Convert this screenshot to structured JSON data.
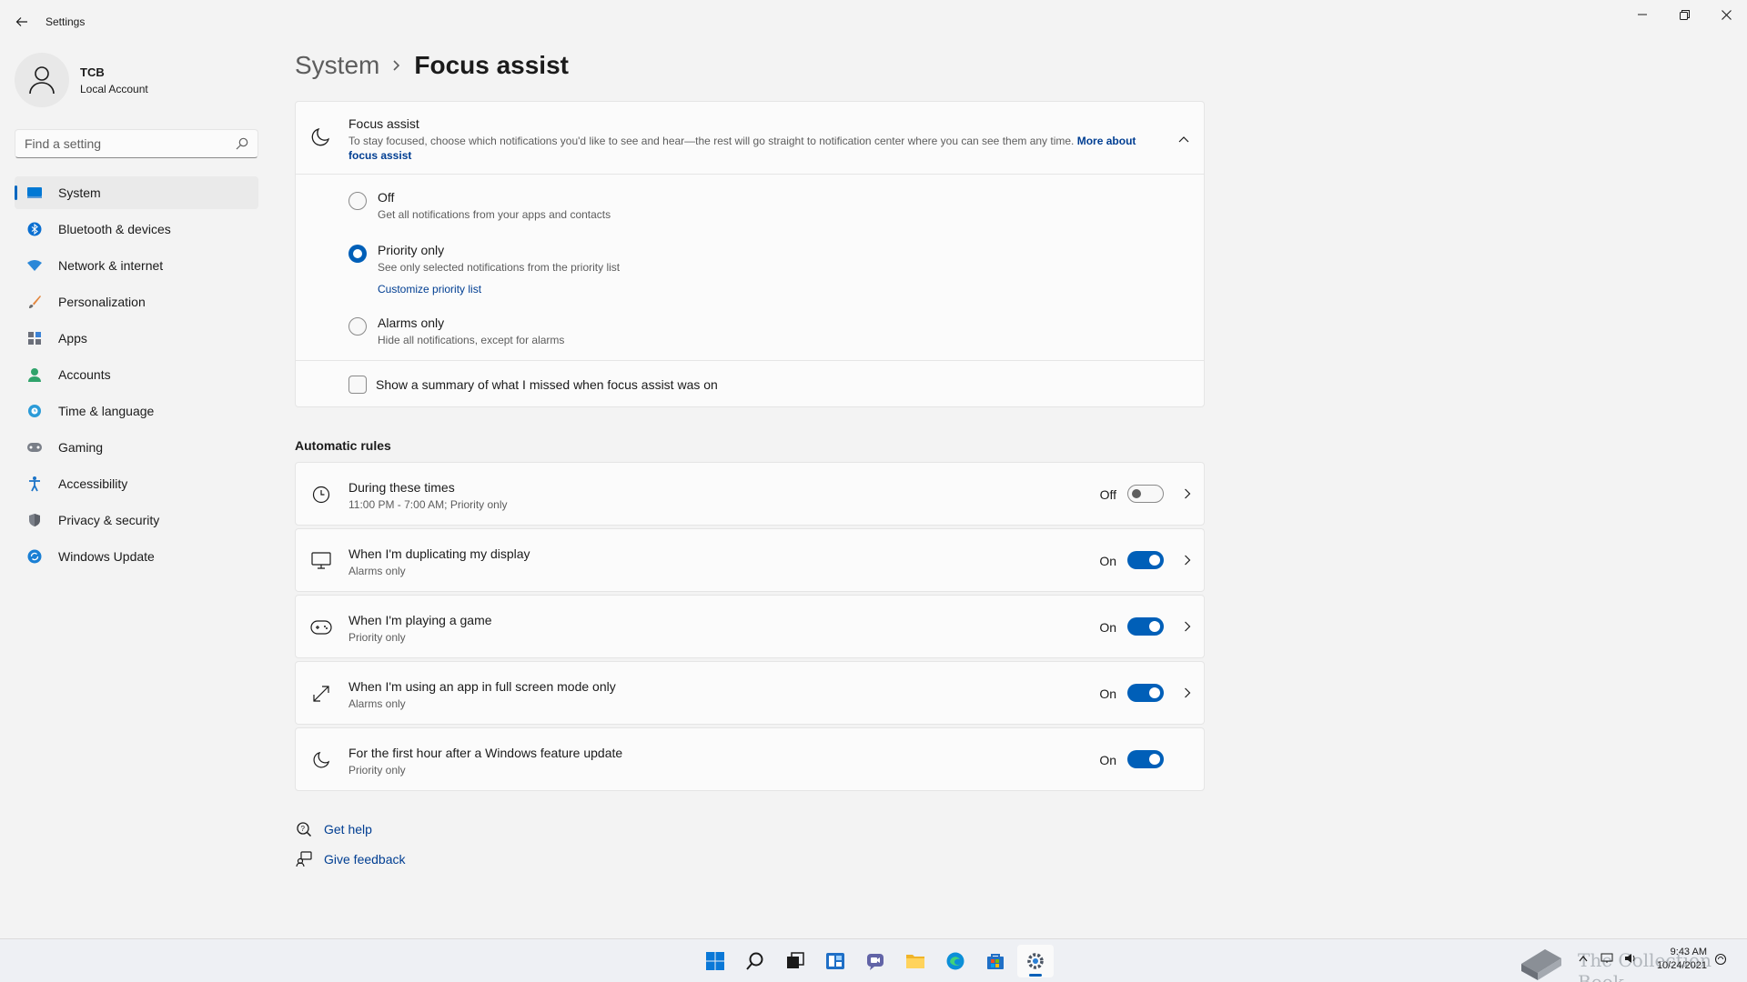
{
  "window": {
    "app_title": "Settings"
  },
  "profile": {
    "name": "TCB",
    "account_type": "Local Account"
  },
  "search": {
    "placeholder": "Find a setting"
  },
  "sidebar": {
    "items": [
      {
        "label": "System",
        "icon": "system-icon",
        "active": true
      },
      {
        "label": "Bluetooth & devices",
        "icon": "bluetooth-icon"
      },
      {
        "label": "Network & internet",
        "icon": "wifi-icon"
      },
      {
        "label": "Personalization",
        "icon": "brush-icon"
      },
      {
        "label": "Apps",
        "icon": "apps-icon"
      },
      {
        "label": "Accounts",
        "icon": "accounts-icon"
      },
      {
        "label": "Time & language",
        "icon": "globe-clock-icon"
      },
      {
        "label": "Gaming",
        "icon": "gamepad-icon"
      },
      {
        "label": "Accessibility",
        "icon": "accessibility-icon"
      },
      {
        "label": "Privacy & security",
        "icon": "shield-icon"
      },
      {
        "label": "Windows Update",
        "icon": "update-icon"
      }
    ]
  },
  "breadcrumb": {
    "parent": "System",
    "current": "Focus assist"
  },
  "focus_assist": {
    "title": "Focus assist",
    "description": "To stay focused, choose which notifications you'd like to see and hear—the rest will go straight to notification center where you can see them any time.",
    "more_link": "More about focus assist",
    "options": [
      {
        "label": "Off",
        "sub": "Get all notifications from your apps and contacts",
        "checked": false
      },
      {
        "label": "Priority only",
        "sub": "See only selected notifications from the priority list",
        "link": "Customize priority list",
        "checked": true
      },
      {
        "label": "Alarms only",
        "sub": "Hide all notifications, except for alarms",
        "checked": false
      }
    ],
    "summary_checkbox": {
      "label": "Show a summary of what I missed when focus assist was on",
      "checked": false
    }
  },
  "automatic_rules": {
    "heading": "Automatic rules",
    "rules": [
      {
        "title": "During these times",
        "sub": "11:00 PM - 7:00 AM; Priority only",
        "state": "Off",
        "on": false,
        "icon": "clock-icon",
        "chevron": true
      },
      {
        "title": "When I'm duplicating my display",
        "sub": "Alarms only",
        "state": "On",
        "on": true,
        "icon": "monitor-icon",
        "chevron": true
      },
      {
        "title": "When I'm playing a game",
        "sub": "Priority only",
        "state": "On",
        "on": true,
        "icon": "gamepad-icon",
        "chevron": true
      },
      {
        "title": "When I'm using an app in full screen mode only",
        "sub": "Alarms only",
        "state": "On",
        "on": true,
        "icon": "fullscreen-icon",
        "chevron": true
      },
      {
        "title": "For the first hour after a Windows feature update",
        "sub": "Priority only",
        "state": "On",
        "on": true,
        "icon": "moon-icon",
        "chevron": false
      }
    ]
  },
  "help": {
    "get_help": "Get help",
    "give_feedback": "Give feedback"
  },
  "taskbar": {
    "apps": [
      "start-icon",
      "search-icon",
      "task-view-icon",
      "widgets-icon",
      "chat-icon",
      "file-explorer-icon",
      "edge-icon",
      "store-icon",
      "settings-icon"
    ],
    "watermark_text": "The Collection Book",
    "clock_time": "9:43 AM",
    "clock_date": "10/24/2021"
  },
  "colors": {
    "accent": "#005fb8",
    "link": "#003e92",
    "background": "#f3f3f3",
    "card": "#fbfbfb"
  }
}
